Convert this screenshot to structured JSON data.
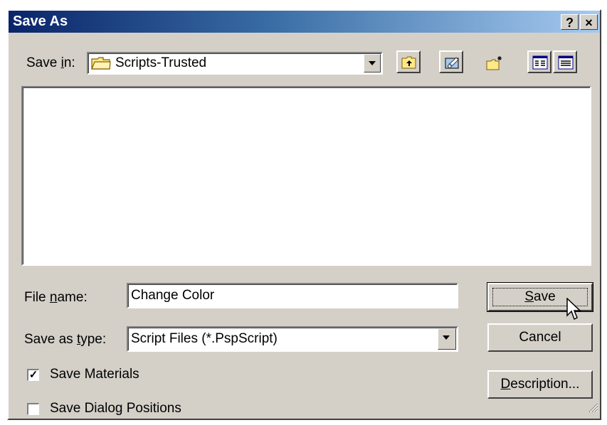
{
  "window": {
    "title": "Save As",
    "help_button": "?",
    "close_button": "×"
  },
  "save_in": {
    "label_prefix": "Save ",
    "label_accel": "i",
    "label_suffix": "n:",
    "value": "Scripts-Trusted",
    "folder_icon": "folder-icon"
  },
  "toolbar": {
    "icons": [
      "up-one-level-icon",
      "desktop-icon",
      "new-folder-icon",
      "list-view-icon",
      "details-view-icon"
    ]
  },
  "file_name": {
    "label_prefix": "File ",
    "label_accel": "n",
    "label_suffix": "ame:",
    "value": "Change Color"
  },
  "save_as_type": {
    "label_prefix": "Save as ",
    "label_accel": "t",
    "label_suffix": "ype:",
    "value": "Script Files (*.PspScript)"
  },
  "options": {
    "save_materials": {
      "label": "Save Materials",
      "checked": true
    },
    "save_dialog_positions": {
      "label": "Save Dialog Positions",
      "checked": false
    }
  },
  "buttons": {
    "save": {
      "accel": "S",
      "rest": "ave"
    },
    "cancel": "Cancel",
    "description": {
      "accel": "D",
      "rest": "escription..."
    }
  }
}
